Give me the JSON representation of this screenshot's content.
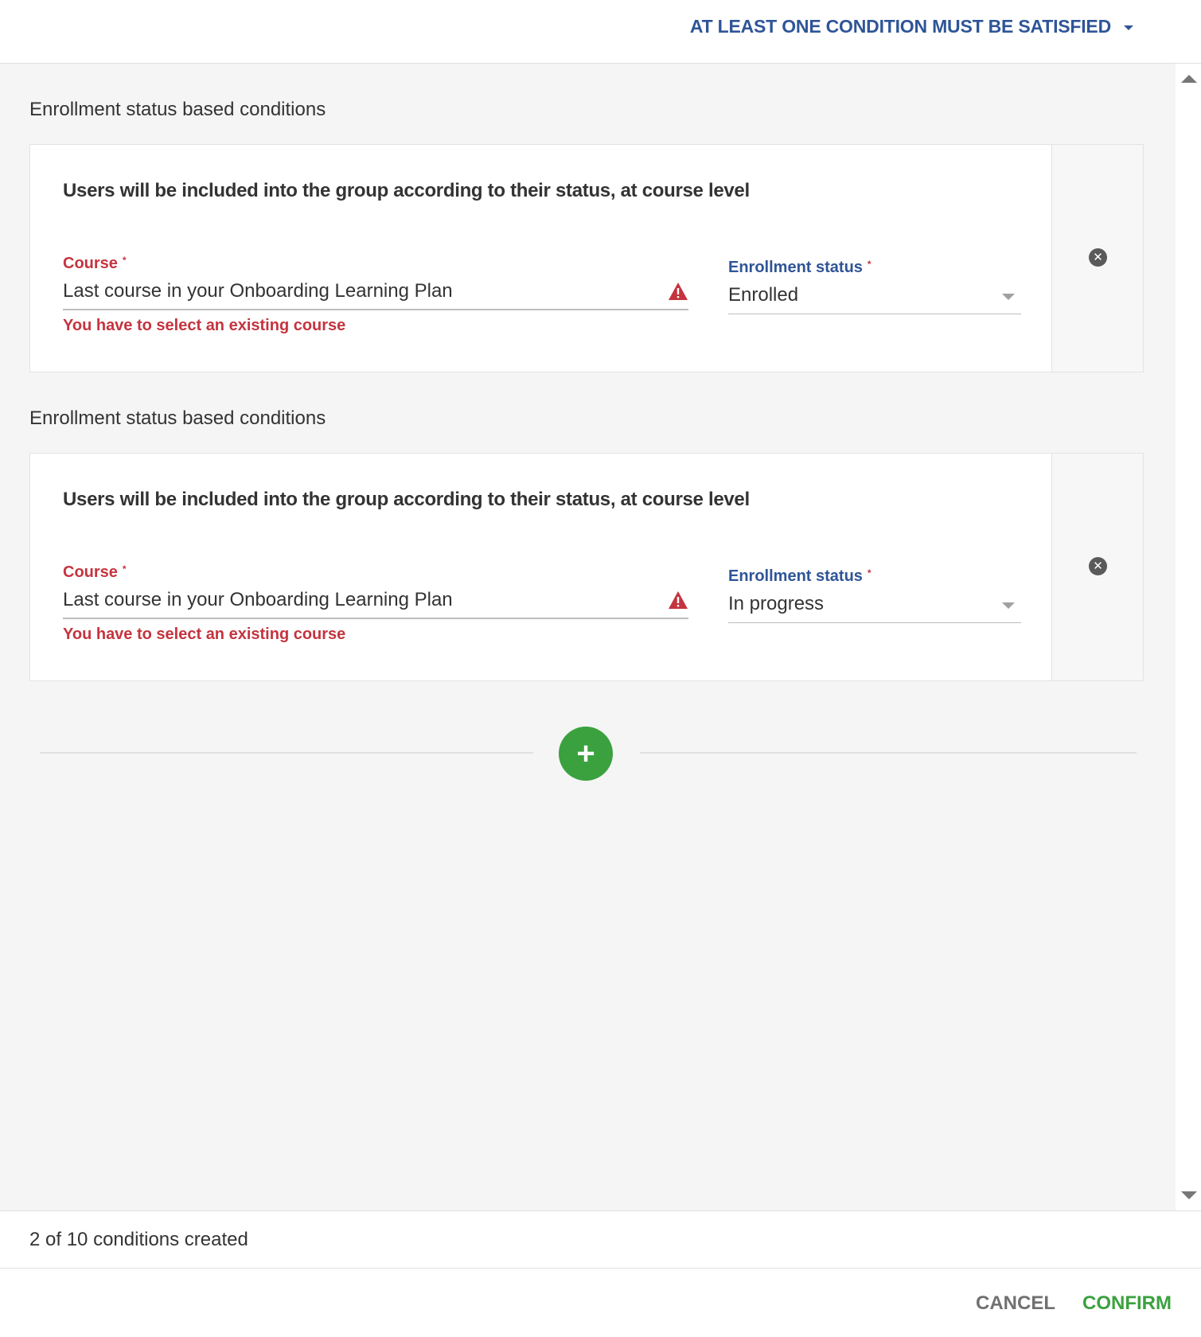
{
  "header": {
    "logic_label": "AT LEAST ONE CONDITION MUST BE SATISFIED"
  },
  "conditions": [
    {
      "section_title": "Enrollment status based conditions",
      "heading": "Users will be included into the group according to their status, at course level",
      "course_label": "Course",
      "required_mark": "*",
      "course_value": "Last course in your Onboarding Learning Plan",
      "course_error": "You have to select an existing course",
      "status_label": "Enrollment status",
      "status_value": "Enrolled"
    },
    {
      "section_title": "Enrollment status based conditions",
      "heading": "Users will be included into the group according to their status, at course level",
      "course_label": "Course",
      "required_mark": "*",
      "course_value": "Last course in your Onboarding Learning Plan",
      "course_error": "You have to select an existing course",
      "status_label": "Enrollment status",
      "status_value": "In progress"
    }
  ],
  "add_button_symbol": "+",
  "remove_button_symbol": "✕",
  "counter": "2 of 10 conditions created",
  "footer": {
    "cancel_label": "CANCEL",
    "confirm_label": "CONFIRM"
  },
  "colors": {
    "accent_blue": "#2f5597",
    "error_red": "#c4343f",
    "add_green": "#3ba13e",
    "background": "#f5f5f5"
  },
  "icons": [
    "chevron-down-icon",
    "warning-icon",
    "close-circle-icon",
    "plus-icon",
    "scroll-up-icon",
    "scroll-down-icon"
  ]
}
